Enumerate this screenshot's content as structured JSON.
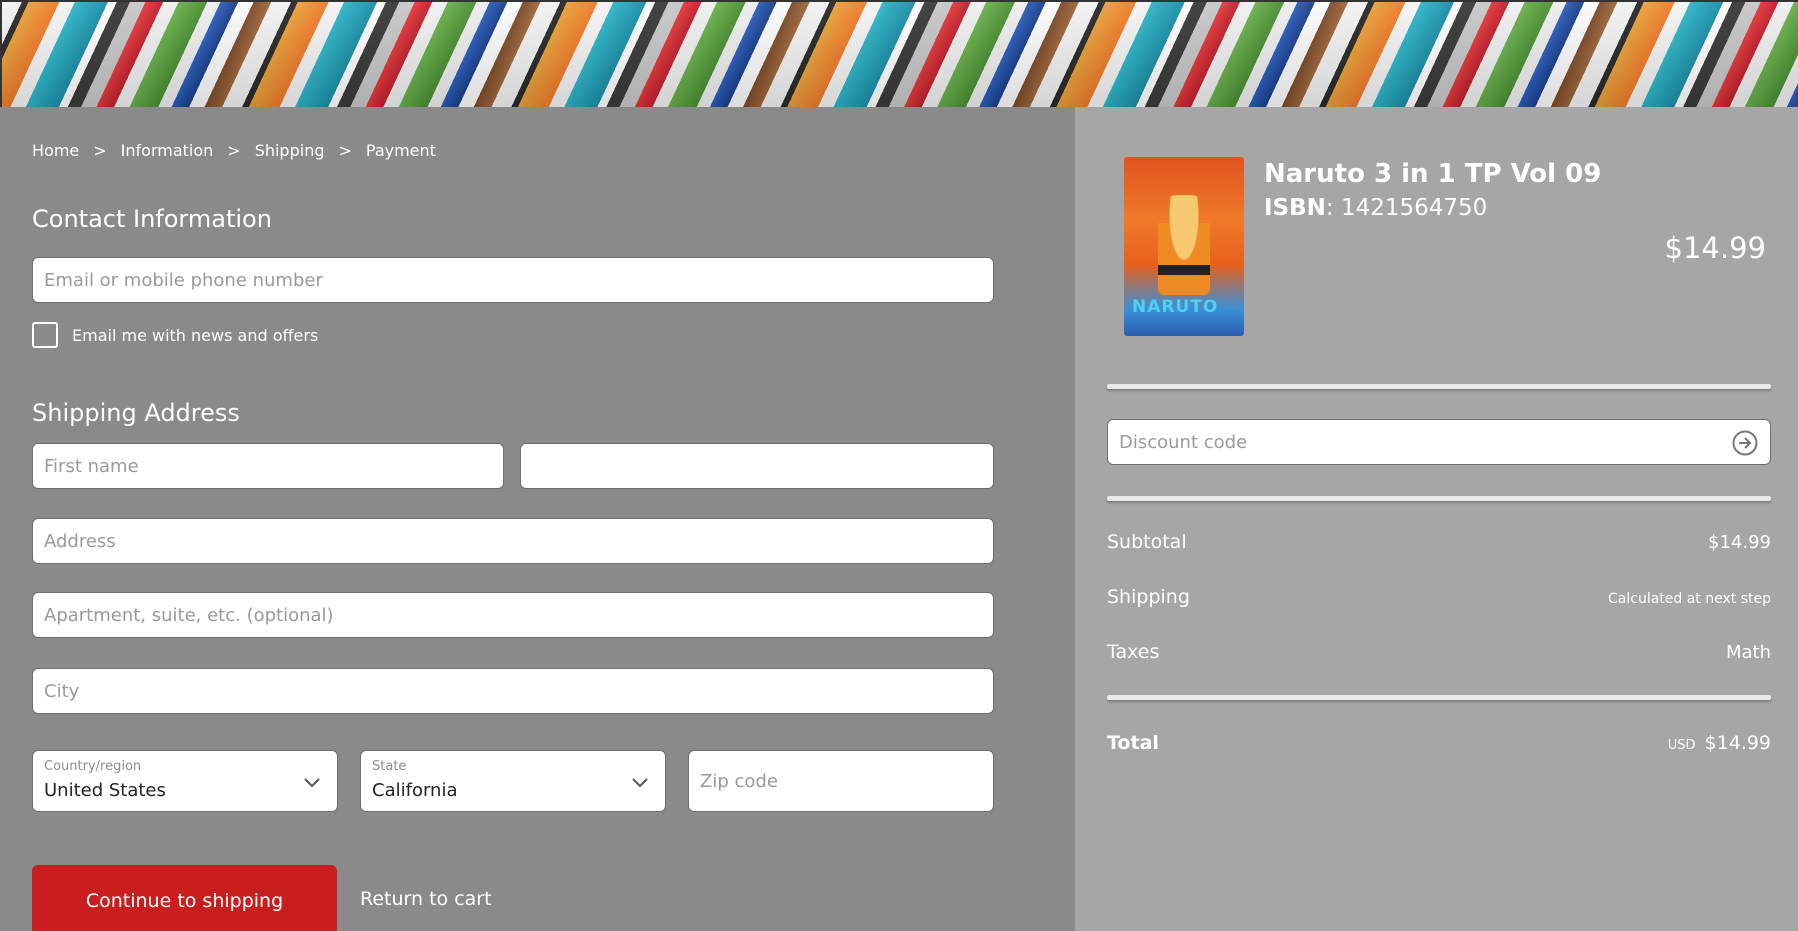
{
  "breadcrumb": {
    "items": [
      "Home",
      "Information",
      "Shipping",
      "Payment"
    ],
    "separator": ">"
  },
  "contact": {
    "title": "Contact Information",
    "email_placeholder": "Email or mobile phone number",
    "newsletter_label": "Email me with news and offers"
  },
  "shipping": {
    "title": "Shipping Address",
    "first_name_placeholder": "First name",
    "last_name_placeholder": "",
    "address_placeholder": "Address",
    "apartment_placeholder": "Apartment, suite, etc. (optional)",
    "city_placeholder": "City",
    "country_label": "Country/region",
    "country_value": "United States",
    "state_label": "State",
    "state_value": "California",
    "zip_placeholder": "Zip code"
  },
  "actions": {
    "continue_label": "Continue to shipping",
    "return_label": "Return to cart"
  },
  "order": {
    "product_title": "Naruto 3 in 1 TP Vol 09",
    "isbn_label": "ISBN",
    "isbn_value": ": 1421564750",
    "product_price": "$14.99",
    "cover_text": "NARUTO",
    "discount_placeholder": "Discount code",
    "subtotal_label": "Subtotal",
    "subtotal_value": "$14.99",
    "shipping_label": "Shipping",
    "shipping_value": "Calculated at next step",
    "taxes_label": "Taxes",
    "taxes_value": "Math",
    "total_label": "Total",
    "total_currency": "USD",
    "total_value": "$14.99"
  },
  "colors": {
    "primary_button": "#c91e1e",
    "left_bg": "#8a8a8a",
    "right_bg": "#a6a6a6"
  },
  "icons": {
    "chevron": "chevron-down-icon",
    "apply": "arrow-right-circle-icon"
  }
}
